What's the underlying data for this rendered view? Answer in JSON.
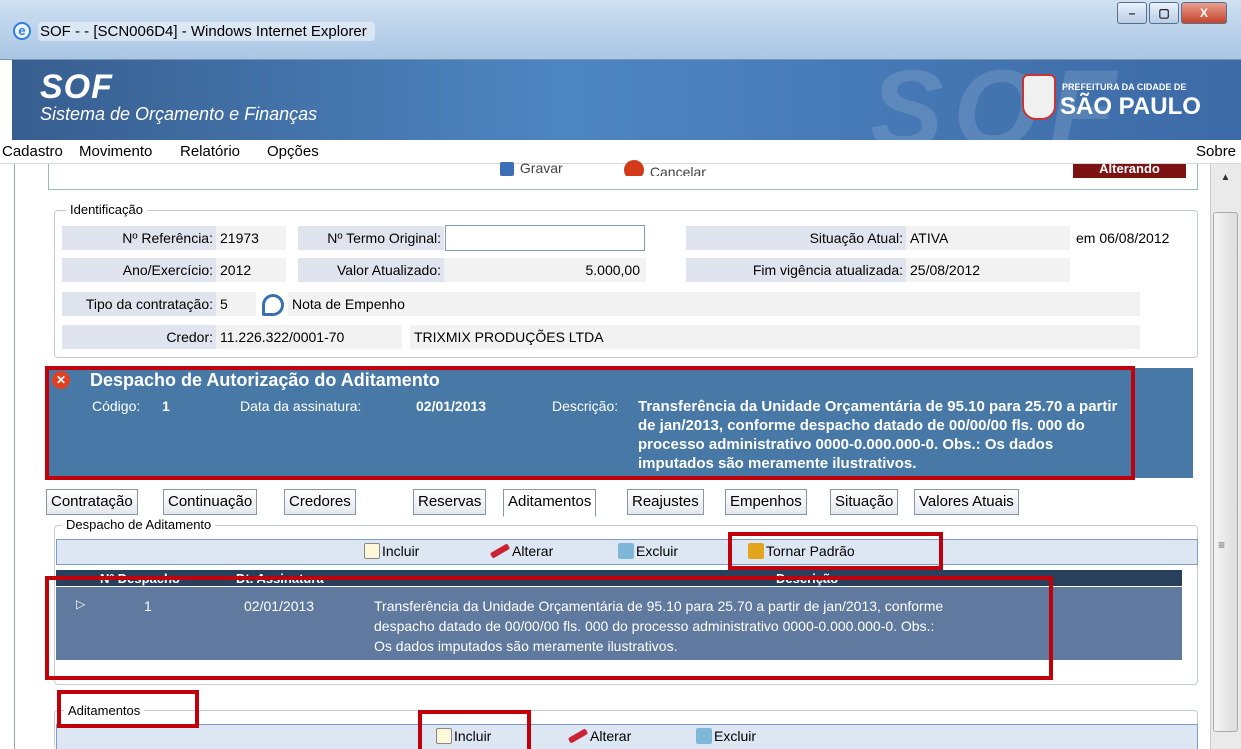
{
  "window": {
    "title": "SOF - - [SCN006D4] - Windows Internet Explorer",
    "buttons": {
      "minimize": "–",
      "maximize": "▢",
      "close": "X"
    }
  },
  "banner": {
    "logo": "SOF",
    "subtitle": "Sistema de Orçamento e Finanças",
    "prefeitura_small": "PREFEITURA DA CIDADE DE",
    "prefeitura_big": "SÃO PAULO"
  },
  "menu": {
    "items": [
      "Cadastro",
      "Movimento",
      "Relatório",
      "Opções"
    ],
    "right": "Sobre"
  },
  "actions": {
    "gravar": "Gravar",
    "cancelar": "Cancelar",
    "status": "Alterando"
  },
  "identificacao": {
    "legend": "Identificação",
    "ref_label": "Nº Referência:",
    "ref_value": "21973",
    "termo_label": "Nº Termo Original:",
    "termo_value": "",
    "situacao_label": "Situação Atual:",
    "situacao_value": "ATIVA",
    "situacao_date": "em 06/08/2012",
    "ano_label": "Ano/Exercício:",
    "ano_value": "2012",
    "valor_label": "Valor Atualizado:",
    "valor_value": "5.000,00",
    "fim_label": "Fim vigência atualizada:",
    "fim_value": "25/08/2012",
    "tipo_label": "Tipo da contratação:",
    "tipo_value": "5",
    "tipo_desc": "Nota de Empenho",
    "credor_label": "Credor:",
    "credor_cnpj": "11.226.322/0001-70",
    "credor_nome": "TRIXMIX PRODUÇÕES LTDA"
  },
  "despacho": {
    "title": "Despacho de Autorização do Aditamento",
    "codigo_label": "Código:",
    "codigo_value": "1",
    "data_label": "Data da assinatura:",
    "data_value": "02/01/2013",
    "desc_label": "Descrição:",
    "desc_lines": [
      "Transferência da Unidade Orçamentária de 95.10 para 25.70 a partir",
      "de jan/2013, conforme despacho datado de 00/00/00 fls. 000 do",
      "processo administrativo 0000-0.000.000-0. Obs.: Os dados",
      "imputados são meramente ilustrativos."
    ]
  },
  "tabs": [
    "Contratação",
    "Continuação",
    "Credores",
    "Reservas",
    "Aditamentos",
    "Reajustes",
    "Empenhos",
    "Situação",
    "Valores Atuais"
  ],
  "despacho_aditamento": {
    "legend": "Despacho de Aditamento",
    "toolbar": {
      "incluir": "Incluir",
      "alterar": "Alterar",
      "excluir": "Excluir",
      "tornar_padrao": "Tornar Padrão"
    },
    "columns": [
      "Nº Despacho",
      "Dt. Assinatura",
      "Descrição"
    ],
    "row": {
      "marker": "▷",
      "numero": "1",
      "data": "02/01/2013",
      "desc_lines": [
        "Transferência da Unidade Orçamentária de 95.10 para 25.70 a partir de jan/2013, conforme",
        "despacho datado de 00/00/00 fls. 000 do processo administrativo 0000-0.000.000-0. Obs.:",
        "Os dados imputados são meramente ilustrativos."
      ]
    }
  },
  "aditamentos": {
    "legend": "Aditamentos",
    "toolbar": {
      "incluir": "Incluir",
      "alterar": "Alterar",
      "excluir": "Excluir"
    }
  },
  "colors": {
    "highlight": "#c0000a",
    "panel_blue": "#4879a6",
    "grid_header": "#29405c"
  }
}
